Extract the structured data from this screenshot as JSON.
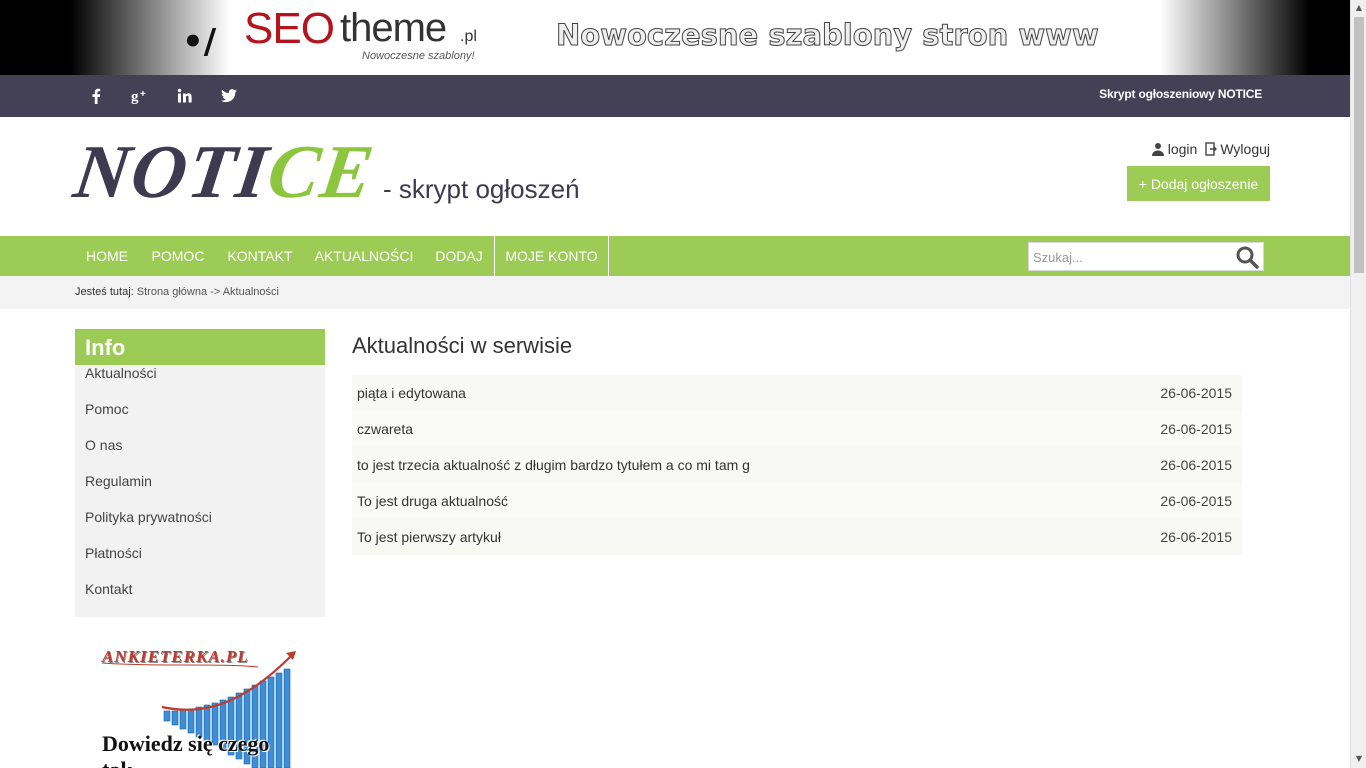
{
  "banner": {
    "logo_seo": "SEO",
    "logo_theme": "theme",
    "logo_pl": ".pl",
    "logo_sub": "Nowoczesne szablony!",
    "slogan": "Nowoczesne szablony stron www"
  },
  "social_bar": {
    "icons": [
      "facebook-icon",
      "google-plus-icon",
      "linkedin-icon",
      "twitter-icon"
    ],
    "text": "Skrypt ogłoszeniowy NOTICE"
  },
  "header": {
    "logo_part1": "NOTI",
    "logo_part2": "CE",
    "tagline": "- skrypt ogłoszeń",
    "login_label": "login",
    "logout_label": "Wyloguj",
    "add_button": "+ Dodaj ogłoszenie"
  },
  "nav": {
    "items": [
      "HOME",
      "POMOC",
      "KONTAKT",
      "AKTUALNOŚCI",
      "DODAJ",
      "MOJE KONTO"
    ],
    "search_placeholder": "Szukaj..."
  },
  "breadcrumb": {
    "prefix": "Jesteś tutaj:",
    "home": "Strona główna",
    "separator": "->",
    "current": "Aktualności"
  },
  "sidebar": {
    "title": "Info",
    "items": [
      "Aktualności",
      "Pomoc",
      "O nas",
      "Regulamin",
      "Polityka prywatności",
      "Płatności",
      "Kontakt"
    ]
  },
  "ad": {
    "title": "ANKIETERKA.PL",
    "text": "Dowiedz się czego tak"
  },
  "main": {
    "title": "Aktualności w serwisie",
    "news": [
      {
        "title": "piąta i edytowana",
        "date": "26-06-2015"
      },
      {
        "title": "czwareta",
        "date": "26-06-2015"
      },
      {
        "title": "to jest trzecia aktualność z długim bardzo tytułem a co mi tam g",
        "date": "26-06-2015"
      },
      {
        "title": "To jest druga aktualność",
        "date": "26-06-2015"
      },
      {
        "title": "To jest pierwszy artykuł",
        "date": "26-06-2015"
      }
    ]
  },
  "colors": {
    "accent_green": "#9ccc55",
    "dark_purple": "#444055"
  }
}
